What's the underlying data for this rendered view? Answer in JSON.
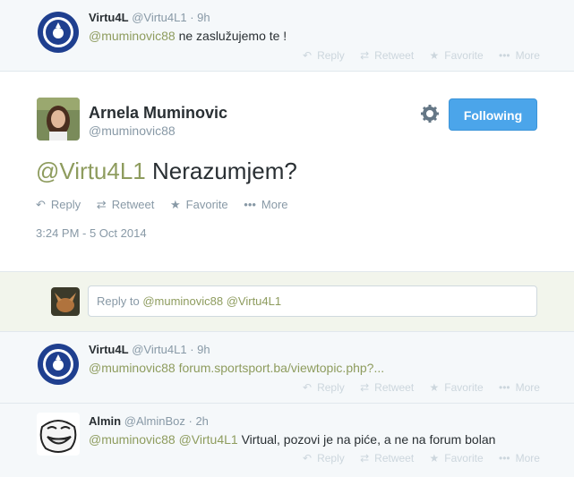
{
  "colors": {
    "accent": "#8e9c5e",
    "follow_button": "#4ba5ea",
    "reply_bg": "#f5f8fa"
  },
  "tweets_before": [
    {
      "name": "Virtu4L",
      "handle": "@Virtu4L1",
      "dot": "·",
      "time": "9h",
      "mention": "@muminovic88",
      "text": " ne zaslužujemo te !",
      "actions": [
        "Reply",
        "Retweet",
        "Favorite",
        "More"
      ]
    }
  ],
  "main_tweet": {
    "name": "Arnela Muminovic",
    "handle": "@muminovic88",
    "follow_label": "Following",
    "mention": "@Virtu4L1",
    "text": " Nerazumjem?",
    "actions": [
      "Reply",
      "Retweet",
      "Favorite",
      "More"
    ],
    "timestamp": "3:24 PM - 5 Oct 2014"
  },
  "reply_box": {
    "prefix": "Reply to ",
    "mention1": "@muminovic88",
    "mention2": "@Virtu4L1"
  },
  "replies": [
    {
      "name": "Virtu4L",
      "handle": "@Virtu4L1",
      "dot": "·",
      "time": "9h",
      "mention": "@muminovic88",
      "text": " forum.sportsport.ba/viewtopic.php?...",
      "actions": [
        "Reply",
        "Retweet",
        "Favorite",
        "More"
      ]
    },
    {
      "name": "Almin",
      "handle": "@AlminBoz",
      "dot": "·",
      "time": "2h",
      "mention": "@muminovic88 @Virtu4L1",
      "text": " Virtual, pozovi je na piće, a ne na forum bolan",
      "actions": [
        "Reply",
        "Retweet",
        "Favorite",
        "More"
      ]
    }
  ]
}
